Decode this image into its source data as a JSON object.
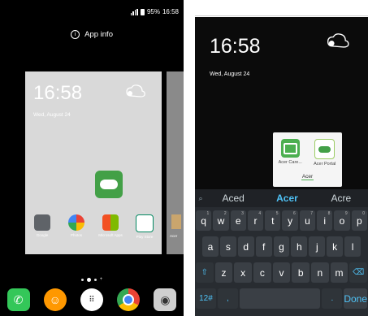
{
  "left": {
    "status": {
      "battery": "95%",
      "time": "16:58"
    },
    "app_info_label": "App info",
    "card": {
      "time": "16:58",
      "date": "Wed, August 24",
      "apps": [
        {
          "label": "Google",
          "color": "#5f6368",
          "icon": "google-folder-icon"
        },
        {
          "label": "Photos",
          "color": "#fbbc04",
          "icon": "photos-pinwheel-icon"
        },
        {
          "label": "Microsoft Apps",
          "color": "#f25022",
          "icon": "microsoft-icon"
        },
        {
          "label": "Play Store",
          "color": "#01875f",
          "icon": "play-store-icon"
        }
      ],
      "peek_label": "Acer"
    },
    "dock": [
      {
        "name": "phone",
        "color": "#34c759",
        "icon": "phone-icon"
      },
      {
        "name": "messages",
        "color": "#ff9800",
        "icon": "messaging-icon"
      },
      {
        "name": "app drawer",
        "color": "#ffffff",
        "icon": "apps-grid-icon"
      },
      {
        "name": "chrome",
        "color": "#4285f4",
        "icon": "chrome-icon"
      },
      {
        "name": "camera",
        "color": "#6d6d6d",
        "icon": "camera-icon"
      }
    ]
  },
  "right": {
    "time": "16:58",
    "date": "Wed, August 24",
    "popup": {
      "items": [
        {
          "label": "Acer Care..."
        },
        {
          "label": "Acer Portal"
        }
      ],
      "field_text": "Acer"
    },
    "suggestions": [
      "Aced",
      "Acer",
      "Acre"
    ],
    "rows": [
      [
        {
          "k": "q",
          "s": "1"
        },
        {
          "k": "w",
          "s": "2"
        },
        {
          "k": "e",
          "s": "3"
        },
        {
          "k": "r",
          "s": "4"
        },
        {
          "k": "t",
          "s": "5"
        },
        {
          "k": "y",
          "s": "6"
        },
        {
          "k": "u",
          "s": "7"
        },
        {
          "k": "i",
          "s": "8"
        },
        {
          "k": "o",
          "s": "9"
        },
        {
          "k": "p",
          "s": "0"
        }
      ],
      [
        {
          "k": "a",
          "s": ""
        },
        {
          "k": "s",
          "s": ""
        },
        {
          "k": "d",
          "s": ""
        },
        {
          "k": "f",
          "s": ""
        },
        {
          "k": "g",
          "s": ""
        },
        {
          "k": "h",
          "s": ""
        },
        {
          "k": "j",
          "s": ""
        },
        {
          "k": "k",
          "s": ""
        },
        {
          "k": "l",
          "s": ""
        }
      ],
      [
        {
          "k": "⇧",
          "s": ""
        },
        {
          "k": "z",
          "s": ""
        },
        {
          "k": "x",
          "s": ""
        },
        {
          "k": "c",
          "s": ""
        },
        {
          "k": "v",
          "s": ""
        },
        {
          "k": "b",
          "s": ""
        },
        {
          "k": "n",
          "s": ""
        },
        {
          "k": "m",
          "s": ""
        },
        {
          "k": "⌫",
          "s": ""
        }
      ],
      [
        {
          "k": "12#",
          "s": ""
        },
        {
          "k": ",",
          "s": ""
        },
        {
          "k": " ",
          "s": ""
        },
        {
          "k": ".",
          "s": ""
        },
        {
          "k": "Done",
          "s": ""
        }
      ]
    ]
  }
}
